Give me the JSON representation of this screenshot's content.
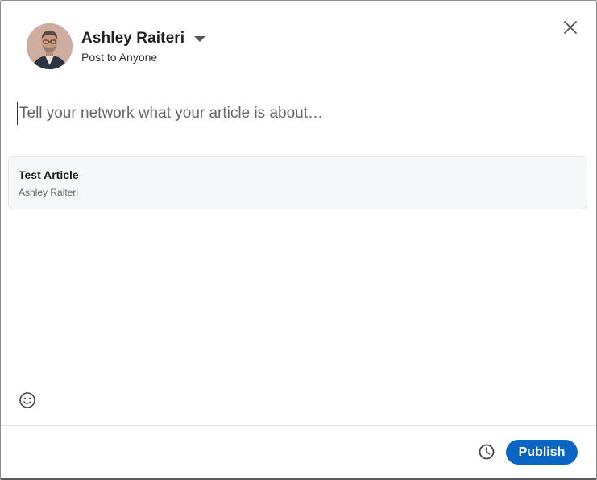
{
  "header": {
    "author_name": "Ashley Raiteri",
    "audience": "Post to Anyone",
    "avatar_icon": "avatar-photo",
    "dropdown_icon": "caret-down-icon",
    "close_icon": "close-icon"
  },
  "composer": {
    "placeholder": "Tell your network what your article is about…",
    "value": ""
  },
  "article_card": {
    "title": "Test Article",
    "author": "Ashley Raiteri"
  },
  "toolbar": {
    "emoji_icon": "emoji-icon"
  },
  "footer": {
    "schedule_icon": "clock-icon",
    "publish_label": "Publish"
  },
  "colors": {
    "accent": "#0a66c2",
    "card_background": "#f6f7f9"
  }
}
